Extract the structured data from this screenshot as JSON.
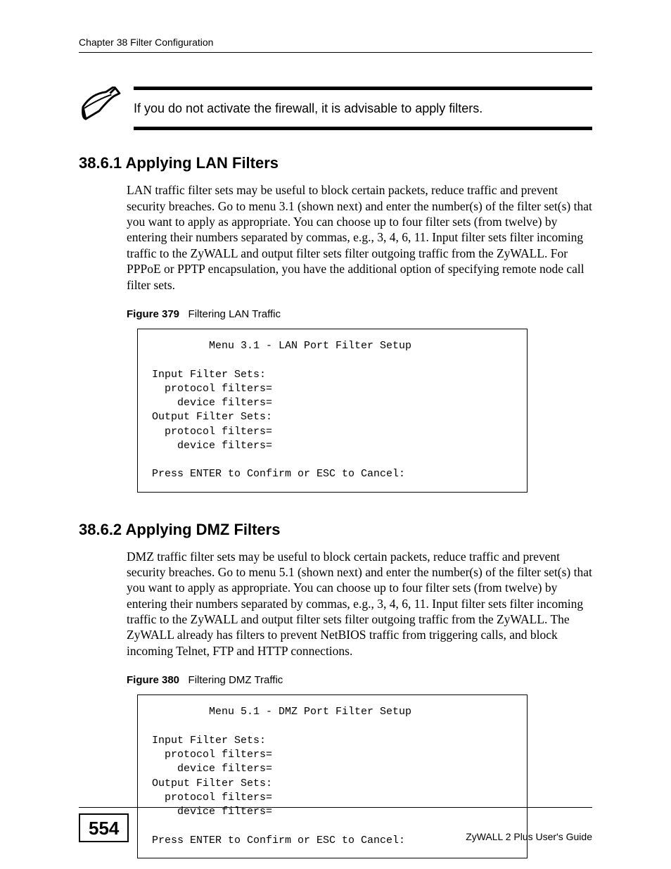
{
  "header": {
    "text": "Chapter 38 Filter Configuration"
  },
  "callout": {
    "text": "If you do not activate the firewall, it is advisable to apply filters."
  },
  "section1": {
    "heading": "38.6.1  Applying LAN Filters",
    "body": "LAN traffic filter sets may be useful to block certain packets, reduce traffic and prevent security breaches. Go to menu 3.1 (shown next) and enter the number(s) of the filter set(s) that you want to apply as appropriate. You can choose up to four filter sets (from twelve) by entering their numbers separated by commas, e.g., 3, 4, 6, 11. Input filter sets filter incoming traffic to the ZyWALL and output filter sets filter outgoing traffic from the ZyWALL. For PPPoE or PPTP encapsulation, you have the additional option of specifying remote node call filter sets.",
    "figure": {
      "label": "Figure 379",
      "title": "Filtering LAN Traffic"
    },
    "screen": "         Menu 3.1 - LAN Port Filter Setup\n\nInput Filter Sets:\n  protocol filters=\n    device filters=\nOutput Filter Sets:\n  protocol filters=\n    device filters=\n\nPress ENTER to Confirm or ESC to Cancel:"
  },
  "section2": {
    "heading": "38.6.2  Applying DMZ Filters",
    "body": "DMZ traffic filter sets may be useful to block certain packets, reduce traffic and prevent security breaches. Go to menu 5.1 (shown next) and enter the number(s) of the filter set(s) that you want to apply as appropriate. You can choose up to four filter sets (from twelve) by entering their numbers separated by commas, e.g., 3, 4, 6, 11. Input filter sets filter incoming traffic to the ZyWALL and output filter sets filter outgoing traffic from the ZyWALL. The ZyWALL already has filters to prevent NetBIOS traffic from triggering calls, and block incoming Telnet, FTP and HTTP connections.",
    "figure": {
      "label": "Figure 380",
      "title": "Filtering DMZ Traffic"
    },
    "screen": "         Menu 5.1 - DMZ Port Filter Setup\n\nInput Filter Sets:\n  protocol filters=\n    device filters=\nOutput Filter Sets:\n  protocol filters=\n    device filters=\n\nPress ENTER to Confirm or ESC to Cancel:"
  },
  "footer": {
    "page": "554",
    "guide": "ZyWALL 2 Plus User's Guide"
  }
}
